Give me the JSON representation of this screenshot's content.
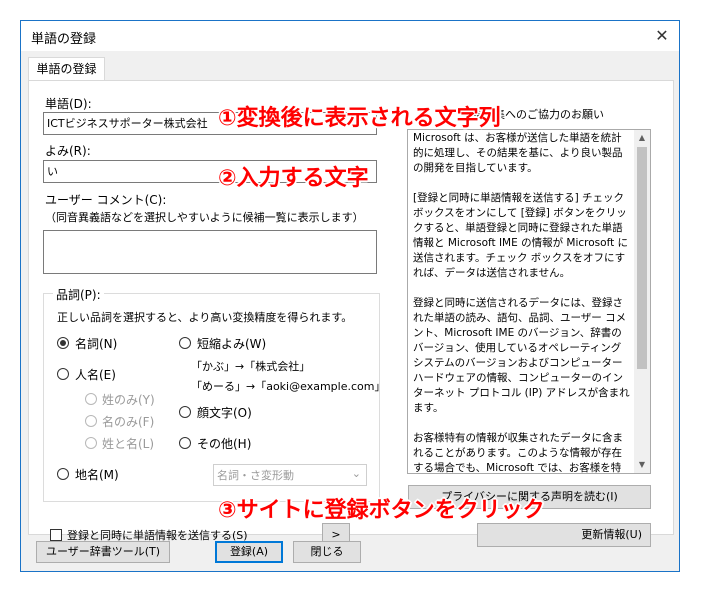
{
  "window": {
    "title": "単語の登録",
    "close_glyph": "✕"
  },
  "tab": {
    "label": "単語の登録"
  },
  "fields": {
    "word_label": "単語(D):",
    "word_value": "ICTビジネスサポーター株式会社",
    "reading_label": "よみ(R):",
    "reading_value": "い",
    "comment_label": "ユーザー コメント(C):",
    "comment_hint": "（同音異義語などを選択しやすいように候補一覧に表示します）",
    "comment_value": ""
  },
  "pos": {
    "group_label": "品詞(P):",
    "hint": "正しい品詞を選択すると、より高い変換精度を得られます。",
    "noun": "名詞(N)",
    "person": "人名(E)",
    "surname_only": "姓のみ(Y)",
    "given_only": "名のみ(F)",
    "full_name": "姓と名(L)",
    "place": "地名(M)",
    "abbrev": "短縮よみ(W)",
    "abbrev_example1": "「かぶ」→「株式会社」",
    "abbrev_example2": "「めーる」→「aoki@example.com」",
    "emoticon": "顔文字(O)",
    "other": "その他(H)",
    "select_value": "名詞・さ変形動"
  },
  "options": {
    "send_info_label": "登録と同時に単語情報を送信する(S)",
    "arrow_label": ">"
  },
  "privacy": {
    "heading": "単語収集へのご協力のお願い",
    "paragraphs": [
      "Microsoft は、お客様が送信した単語を統計的に処理し、その結果を基に、より良い製品の開発を目指しています。",
      "[登録と同時に単語情報を送信する] チェック ボックスをオンにして [登録] ボタンをクリックすると、単語登録と同時に登録された単語情報と Microsoft IME の情報が Microsoft に送信されます。チェック ボックスをオフにすれば、データは送信されません。",
      "登録と同時に送信されるデータには、登録された単語の読み、語句、品詞、ユーザー コメント、Microsoft IME のバージョン、辞書のバージョン、使用しているオペレーティング システムのバージョンおよびコンピューター ハードウェアの情報、コンピューターのインターネット プロトコル (IP) アドレスが含まれます。",
      "お客様特有の情報が収集されたデータに含まれることがあります。このような情報が存在する場合でも、Microsoft では、お客様を特定するために使用することはありません。"
    ],
    "privacy_button": "プライバシーに関する声明を読む(I)",
    "update_button": "更新情報(U)"
  },
  "buttons": {
    "user_dict": "ユーザー辞書ツール(T)",
    "register": "登録(A)",
    "close": "閉じる"
  },
  "annotations": {
    "a1": "①変換後に表示される文字列",
    "a2": "②入力する文字",
    "a3": "③サイトに登録ボタンをクリック"
  }
}
